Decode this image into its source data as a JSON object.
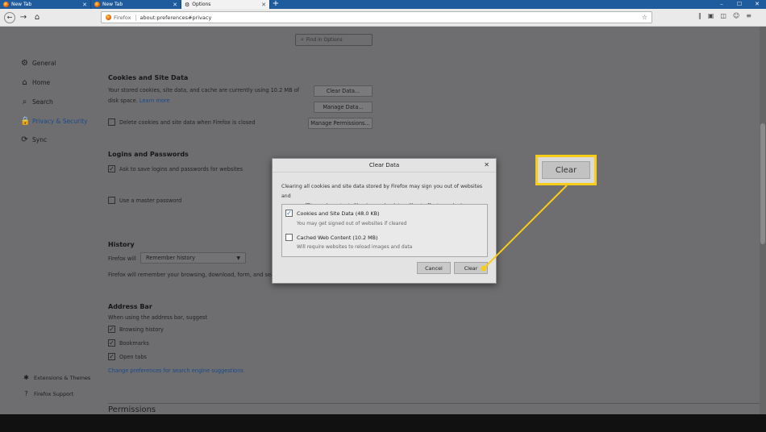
{
  "tabs": [
    {
      "title": "New Tab",
      "active": false
    },
    {
      "title": "New Tab",
      "active": false
    },
    {
      "title": "Options",
      "active": true
    }
  ],
  "navbar": {
    "brand": "Firefox",
    "url": "about:preferences#privacy"
  },
  "search": {
    "placeholder": "Find in Options"
  },
  "sidebar": {
    "items": [
      {
        "label": "General",
        "icon": "gear-icon"
      },
      {
        "label": "Home",
        "icon": "home-icon"
      },
      {
        "label": "Search",
        "icon": "search-icon"
      },
      {
        "label": "Privacy & Security",
        "icon": "lock-icon",
        "selected": true
      },
      {
        "label": "Sync",
        "icon": "sync-icon"
      }
    ],
    "footer": [
      {
        "label": "Extensions & Themes",
        "icon": "puzzle-icon"
      },
      {
        "label": "Firefox Support",
        "icon": "help-icon"
      }
    ]
  },
  "cookies": {
    "heading": "Cookies and Site Data",
    "desc1": "Your stored cookies, site data, and cache are currently using 10.2 MB of",
    "desc2": "disk space.",
    "learn_more": "Learn more",
    "clear_btn": "Clear Data...",
    "manage_btn": "Manage Data...",
    "permissions_btn": "Manage Permissions...",
    "delete_label": "Delete cookies and site data when Firefox is closed"
  },
  "logins": {
    "heading": "Logins and Passwords",
    "ask_label": "Ask to save logins and passwords for websites",
    "master_label": "Use a master password"
  },
  "history": {
    "heading": "History",
    "will_label": "Firefox will",
    "select_value": "Remember history",
    "desc": "Firefox will remember your browsing, download, form, and sea"
  },
  "addressbar": {
    "heading": "Address Bar",
    "desc": "When using the address bar, suggest",
    "options": [
      "Browsing history",
      "Bookmarks",
      "Open tabs"
    ],
    "link": "Change preferences for search engine suggestions"
  },
  "permissions": {
    "heading": "Permissions"
  },
  "dialog": {
    "title": "Clear Data",
    "desc1": "Clearing all cookies and site data stored by Firefox may sign you out of websites and",
    "desc2": "remove offline web content. Clearing cache data will not affect your logins.",
    "opt1_label": "Cookies and Site Data (48.0 KB)",
    "opt1_sub": "You may get signed out of websites if cleared",
    "opt2_label": "Cached Web Content (10.2 MB)",
    "opt2_sub": "Will require websites to reload images and data",
    "cancel": "Cancel",
    "clear": "Clear"
  },
  "callout": {
    "label": "Clear",
    "color": "#f8cd1a"
  }
}
